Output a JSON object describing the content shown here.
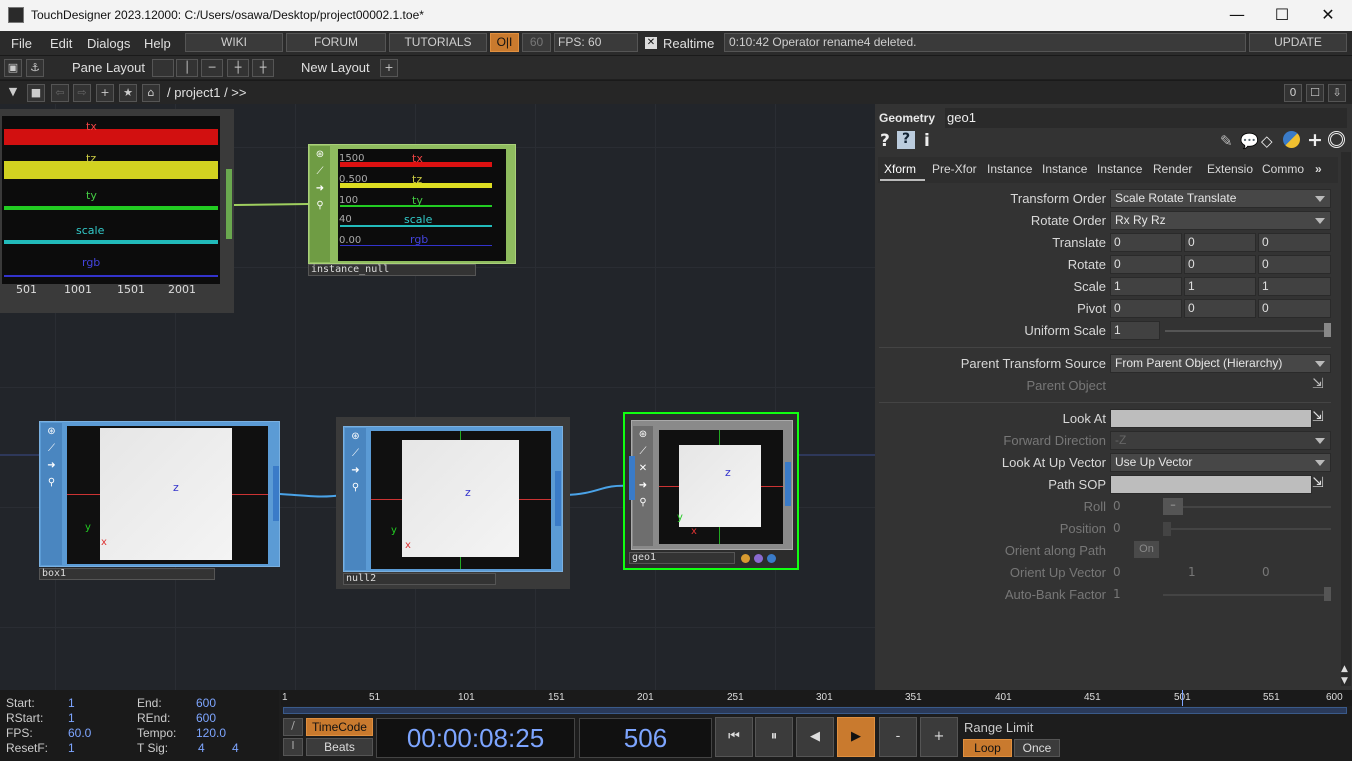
{
  "window": {
    "title": "TouchDesigner 2023.12000: C:/Users/osawa/Desktop/project00002.1.toe*",
    "minimize": "—",
    "maximize": "☐",
    "close": "✕"
  },
  "menu": {
    "items": [
      "File",
      "Edit",
      "Dialogs",
      "Help"
    ],
    "wiki": "WIKI",
    "forum": "FORUM",
    "tutorials": "TUTORIALS",
    "oi": "O|I",
    "fps_box": "60",
    "fps_label": "FPS:",
    "fps_value": "60",
    "realtime": "Realtime",
    "realtime_checked": "✕",
    "status": "0:10:42 Operator rename4 deleted.",
    "update": "UPDATE"
  },
  "toolbar": {
    "pane_layout": "Pane Layout",
    "new_layout": "New Layout",
    "path": "/ project1 / >>",
    "pane_index": "0"
  },
  "nodes": {
    "chop_top": {
      "labels": [
        "tx",
        "tz",
        "ty",
        "scale",
        "rgb"
      ],
      "ticks": [
        "501",
        "1001",
        "1501",
        "2001"
      ]
    },
    "instance_null": {
      "name": "instance_null",
      "labels": [
        "tx",
        "tz",
        "ty",
        "scale",
        "rgb"
      ],
      "values": [
        "1500",
        "0.500",
        "100",
        "40",
        "0.00"
      ]
    },
    "box1": {
      "name": "box1"
    },
    "null2": {
      "name": "null2"
    },
    "geo1": {
      "name": "geo1"
    },
    "axis": {
      "x": "x",
      "y": "y",
      "z": "z"
    }
  },
  "params": {
    "type": "Geometry",
    "name": "geo1",
    "tabs": [
      "Xform",
      "Pre-Xfor",
      "Instance",
      "Instance",
      "Instance",
      "Render",
      "Extensio",
      "Commo"
    ],
    "transform_order": {
      "label": "Transform Order",
      "value": "Scale Rotate Translate"
    },
    "rotate_order": {
      "label": "Rotate Order",
      "value": "Rx Ry Rz"
    },
    "translate": {
      "label": "Translate",
      "values": [
        "0",
        "0",
        "0"
      ]
    },
    "rotate": {
      "label": "Rotate",
      "values": [
        "0",
        "0",
        "0"
      ]
    },
    "scale": {
      "label": "Scale",
      "values": [
        "1",
        "1",
        "1"
      ]
    },
    "pivot": {
      "label": "Pivot",
      "values": [
        "0",
        "0",
        "0"
      ]
    },
    "uniform_scale": {
      "label": "Uniform Scale",
      "value": "1"
    },
    "parent_transform_source": {
      "label": "Parent Transform Source",
      "value": "From Parent Object (Hierarchy)"
    },
    "parent_object": {
      "label": "Parent Object"
    },
    "look_at": {
      "label": "Look At"
    },
    "forward_direction": {
      "label": "Forward Direction",
      "value": "-Z"
    },
    "look_at_up_vector": {
      "label": "Look At Up Vector",
      "value": "Use Up Vector"
    },
    "path_sop": {
      "label": "Path SOP"
    },
    "roll": {
      "label": "Roll",
      "value": "0"
    },
    "position": {
      "label": "Position",
      "value": "0"
    },
    "orient_along_path": {
      "label": "Orient along Path",
      "value": "On"
    },
    "orient_up_vector": {
      "label": "Orient Up Vector",
      "values": [
        "0",
        "1",
        "0"
      ]
    },
    "auto_bank_factor": {
      "label": "Auto-Bank Factor",
      "value": "1"
    }
  },
  "timeline": {
    "start_label": "Start:",
    "start": "1",
    "end_label": "End:",
    "end": "600",
    "rstart_label": "RStart:",
    "rstart": "1",
    "rend_label": "REnd:",
    "rend": "600",
    "fps_label": "FPS:",
    "fps": "60.0",
    "tempo_label": "Tempo:",
    "tempo": "120.0",
    "resetf_label": "ResetF:",
    "resetf": "1",
    "tsig_label": "T Sig:",
    "tsig_a": "4",
    "tsig_b": "4",
    "ticks": [
      "1",
      "51",
      "101",
      "151",
      "201",
      "251",
      "301",
      "351",
      "401",
      "451",
      "501",
      "551",
      "600"
    ],
    "timecode": "TimeCode",
    "beats": "Beats",
    "time": "00:00:08:25",
    "frame": "506",
    "range_limit": "Range Limit",
    "loop": "Loop",
    "once": "Once"
  }
}
